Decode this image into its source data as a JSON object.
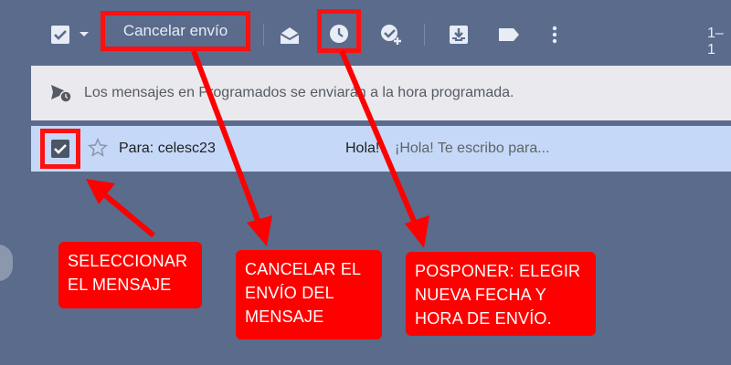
{
  "toolbar": {
    "cancel_label": "Cancelar envío",
    "pager_text": "1–1",
    "icons": [
      "select-checkbox-icon",
      "dropdown-caret-icon",
      "mark-read-icon",
      "snooze-clock-icon",
      "add-task-icon",
      "move-to-icon",
      "label-icon",
      "more-vert-icon"
    ]
  },
  "info_bar": {
    "text": "Los mensajes en Programados se enviarán a la hora programada."
  },
  "message": {
    "to": "Para: celesc23",
    "subject": "Hola!",
    "snippet": "¡Hola! Te escribo para...",
    "selected": true
  },
  "annotations": {
    "select": [
      "SELECCIONAR",
      "EL MENSAJE"
    ],
    "cancel": [
      "CANCELAR EL",
      "ENVÍO DEL",
      "MENSAJE"
    ],
    "postpone": [
      "POSPONER: ELEGIR",
      "NUEVA FECHA Y",
      "HORA DE ENVÍO."
    ]
  },
  "colors": {
    "background": "#5a6b8c",
    "annotation_red": "#ff0000",
    "selected_row": "#c5d8f7",
    "info_bar": "#e9e9ee"
  }
}
